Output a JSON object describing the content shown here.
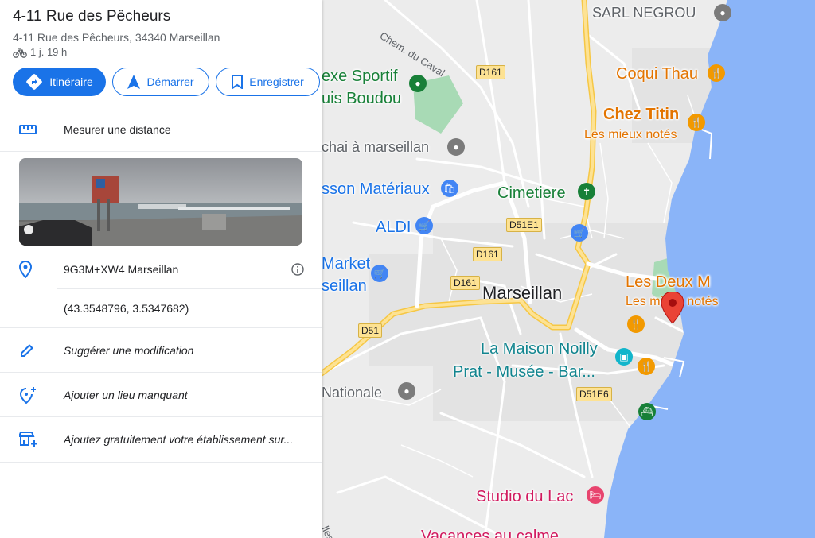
{
  "place": {
    "title": "4-11 Rue des Pêcheurs",
    "address": "4-11 Rue des Pêcheurs, 34340 Marseillan",
    "travel_time": "1 j. 19 h"
  },
  "actions": {
    "directions": "Itinéraire",
    "start": "Démarrer",
    "save": "Enregistrer"
  },
  "measure": "Mesurer une distance",
  "plus_code": "9G3M+XW4 Marseillan",
  "coordinates": "(43.3548796, 3.5347682)",
  "suggest_edit": "Suggérer une modification",
  "add_missing_place": "Ajouter un lieu manquant",
  "add_business": "Ajoutez gratuitement votre établissement sur...",
  "map": {
    "town": "Marseillan",
    "roads": {
      "d161_top": "D161",
      "d51e1": "D51E1",
      "d161_mid": "D161",
      "d161_low": "D161",
      "d51": "D51",
      "d51e6": "D51E6",
      "chem_caval": "Chem. du Caval",
      "bottom_road": "lles"
    },
    "places": {
      "sarl_negrou": "SARL NEGROU",
      "coqui_thau": "Coqui Thau",
      "chez_titin": "Chez Titin",
      "chez_titin_note": "Les mieux notés",
      "complexe_line1": "exe Sportif",
      "complexe_line2": "uis Boudou",
      "chai": "chai à marseillan",
      "materiaux": "sson Matériaux",
      "cimetiere": "Cimetiere",
      "aldi": "ALDI",
      "market_line1": "Market",
      "market_line2": "seillan",
      "les_deux_m": "Les Deux M",
      "les_deux_m_note": "Les mieux notés",
      "maison_line1": "La Maison Noilly",
      "maison_line2": "Prat - Musée - Bar...",
      "nationale": "Nationale",
      "studio": "Studio du Lac",
      "vacances": "Vacances au calme"
    }
  },
  "colors": {
    "accent": "#1a73e8",
    "water": "#8ab4f8",
    "road_major": "#fdd663",
    "pin": "#ea4335"
  }
}
